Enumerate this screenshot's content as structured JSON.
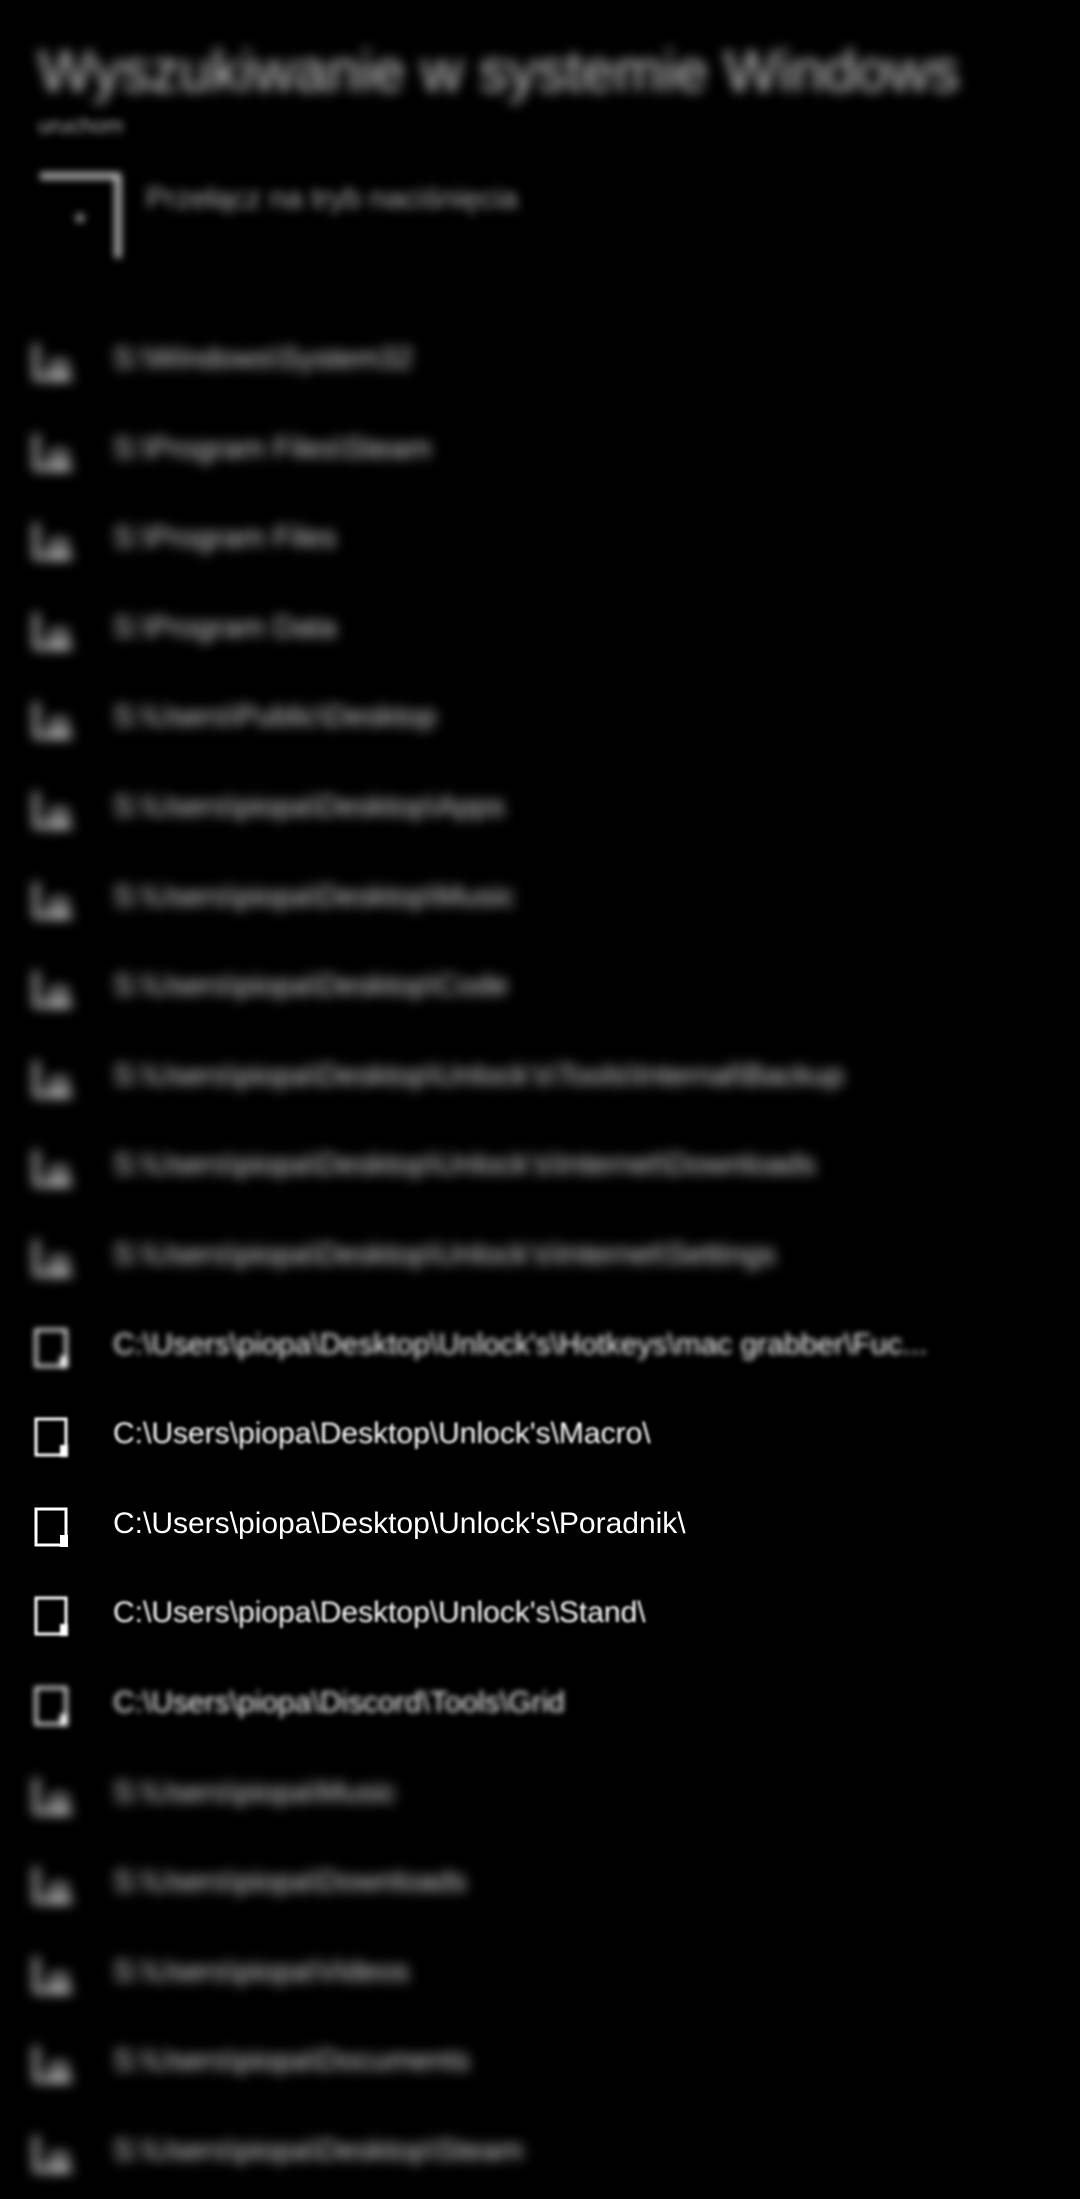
{
  "header": {
    "title": "Wyszukiwanie w systemie Windows",
    "subtitle": "uruchom"
  },
  "top_item": {
    "label": "Przełącz na tryb naciśnięcia"
  },
  "items": [
    {
      "icon": "folder-shortcut-icon",
      "text": "S:\\Windows\\System32"
    },
    {
      "icon": "folder-shortcut-icon",
      "text": "S:\\Program Files\\Steam"
    },
    {
      "icon": "folder-shortcut-icon",
      "text": "S:\\Program Files"
    },
    {
      "icon": "folder-shortcut-icon",
      "text": "S:\\Program Data"
    },
    {
      "icon": "folder-shortcut-icon",
      "text": "S:\\Users\\Public\\Desktop"
    },
    {
      "icon": "folder-shortcut-icon",
      "text": "S:\\Users\\piopa\\Desktop\\Apps"
    },
    {
      "icon": "folder-shortcut-icon",
      "text": "S:\\Users\\piopa\\Desktop\\Music"
    },
    {
      "icon": "folder-shortcut-icon",
      "text": "S:\\Users\\piopa\\Desktop\\Code"
    },
    {
      "icon": "folder-shortcut-icon",
      "text": "S:\\Users\\piopa\\Desktop\\Unlock's\\Tools\\Internal\\Backup"
    },
    {
      "icon": "folder-shortcut-icon",
      "text": "S:\\Users\\piopa\\Desktop\\Unlock's\\Internet\\Downloads"
    },
    {
      "icon": "folder-shortcut-icon",
      "text": "S:\\Users\\piopa\\Desktop\\Unlock's\\Internet\\Settings"
    },
    {
      "icon": "folder-icon",
      "text": "C:\\Users\\piopa\\Desktop\\Unlock's\\Hotkeys\\mac grabber\\Fuc..."
    },
    {
      "icon": "folder-icon",
      "text": "C:\\Users\\piopa\\Desktop\\Unlock's\\Macro\\"
    },
    {
      "icon": "folder-icon",
      "text": "C:\\Users\\piopa\\Desktop\\Unlock's\\Poradnik\\"
    },
    {
      "icon": "folder-icon",
      "text": "C:\\Users\\piopa\\Desktop\\Unlock's\\Stand\\"
    },
    {
      "icon": "folder-icon",
      "text": "C:\\Users\\piopa\\Discord\\Tools\\Grid"
    },
    {
      "icon": "folder-shortcut-icon",
      "text": "S:\\Users\\piopa\\Music"
    },
    {
      "icon": "folder-shortcut-icon",
      "text": "S:\\Users\\piopa\\Downloads"
    },
    {
      "icon": "folder-shortcut-icon",
      "text": "S:\\Users\\piopa\\Videos"
    },
    {
      "icon": "folder-shortcut-icon",
      "text": "S:\\Users\\piopa\\Documents"
    },
    {
      "icon": "folder-shortcut-icon",
      "text": "S:\\Users\\piopa\\Desktop\\Steam"
    }
  ]
}
